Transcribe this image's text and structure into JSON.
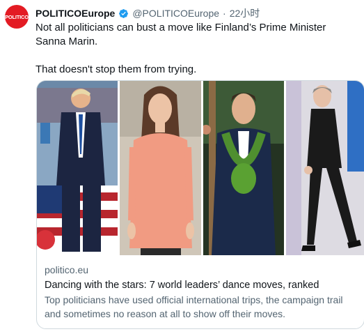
{
  "tweet": {
    "avatar_text": "POLITICO",
    "display_name": "POLITICOEurope",
    "handle": "@POLITICOEurope",
    "separator": "·",
    "time": "22小时",
    "text_line1": "Not all politicians can bust a move like Finland’s Prime Minister Sanna Marin.",
    "text_line2": "That doesn't stop them from trying."
  },
  "card": {
    "domain": "politico.eu",
    "title": "Dancing with the stars: 7 world leaders’ dance moves, ranked",
    "description": "Top politicians have used official international trips, the campaign trail and sometimes no reason at all to show off their moves."
  },
  "icons": {
    "verified": "verified-badge-icon"
  },
  "colors": {
    "brand_red": "#e31b23",
    "verified_blue": "#1d9bf0",
    "secondary_text": "#536471",
    "border": "#cfd9de"
  }
}
